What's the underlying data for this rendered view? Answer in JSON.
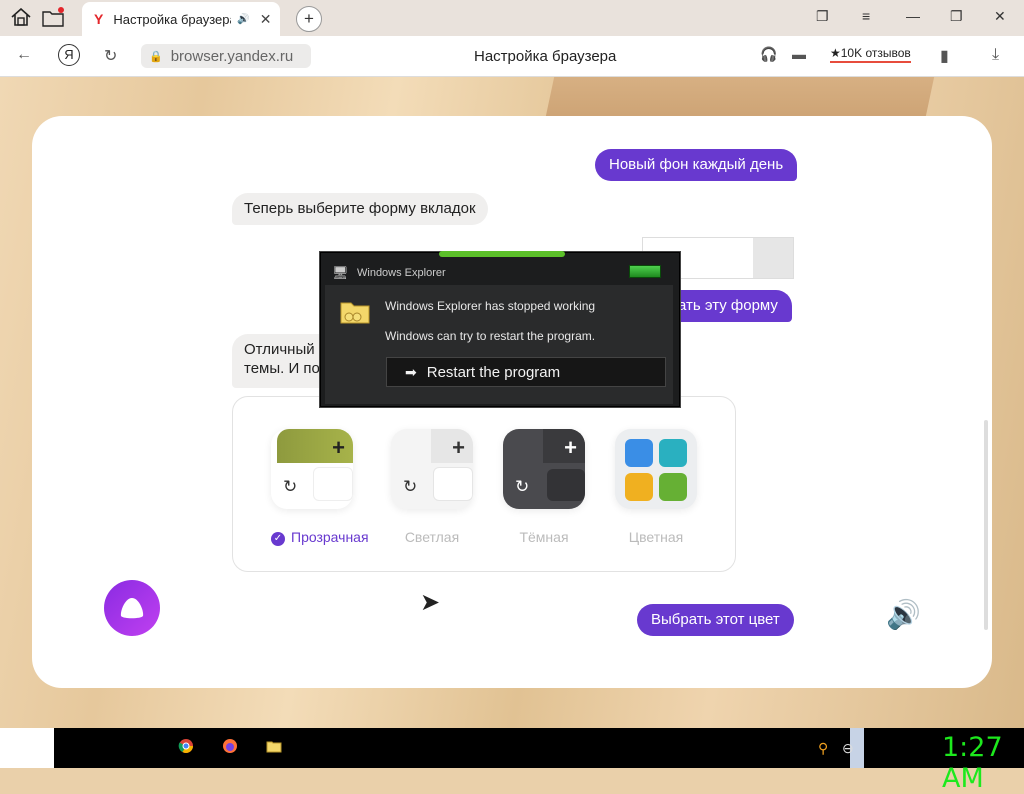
{
  "browser": {
    "tab_title": "Настройка браузера",
    "tab_icon": "Y",
    "url": "browser.yandex.ru",
    "page_title": "Настройка браузера",
    "reviews": "★10K отзывов"
  },
  "chat": {
    "bubble_new_bg": "Новый фон каждый день",
    "prompt_tab_shape": "Теперь выберите форму вкладок",
    "bubble_choose_form": "ать эту форму",
    "msg_line1": "Отличный",
    "msg_line2": "темы. И по"
  },
  "tab_shapes": [
    {
      "label": "Прозрачная",
      "selected": true
    },
    {
      "label": "Светлая",
      "selected": false
    },
    {
      "label": "Тёмная",
      "selected": false
    },
    {
      "label": "Цветная",
      "selected": false
    }
  ],
  "pick_color_button": "Выбрать этот цвет",
  "dialog": {
    "title": "Windows Explorer",
    "line1": "Windows Explorer has stopped working",
    "line2": "Windows can try to restart the program.",
    "restart": "Restart the program"
  },
  "taskbar": {
    "clock": "1:27 AM"
  },
  "colors": {
    "accent": "#6839cf",
    "clock": "#1de91d",
    "error_glow": "#5cc02a"
  }
}
